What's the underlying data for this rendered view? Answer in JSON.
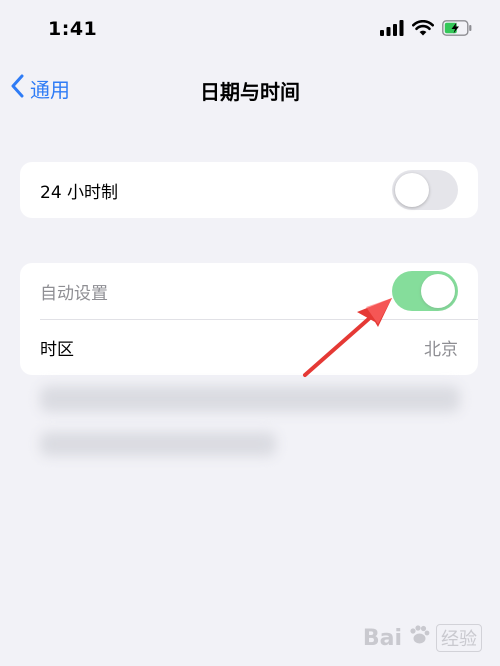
{
  "status_bar": {
    "time": "1:41",
    "icons": [
      "cellular-signal-icon",
      "wifi-icon",
      "battery-charging-icon"
    ]
  },
  "nav": {
    "back_label": "通用",
    "title": "日期与时间"
  },
  "settings": {
    "hour24": {
      "label": "24 小时制",
      "toggle_on": false
    },
    "auto_set": {
      "label": "自动设置",
      "toggle_on": true
    },
    "time_zone": {
      "label": "时区",
      "value": "北京"
    }
  },
  "colors": {
    "accent": "#2f7cf6",
    "toggle_on": "#34c759",
    "toggle_off": "#e5e5ea",
    "annotation_arrow": "#e53935",
    "background": "#f2f2f7"
  },
  "watermark": {
    "brand": "Bai",
    "suffix": "经验"
  }
}
